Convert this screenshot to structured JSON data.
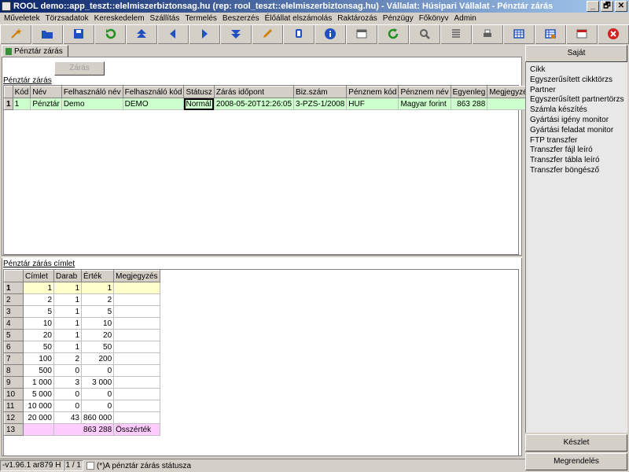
{
  "window": {
    "title": "ROOL demo::app_teszt::elelmiszerbiztonsag.hu (rep: rool_teszt::elelmiszerbiztonsag.hu) - Vállalat: Húsipari Vállalat - Pénztár zárás",
    "controls": [
      "_",
      "🗗",
      "✕"
    ]
  },
  "menu": [
    "Műveletek",
    "Törzsadatok",
    "Kereskedelem",
    "Szállítás",
    "Termelés",
    "Beszerzés",
    "Élőállat elszámolás",
    "Raktározás",
    "Pénzügy",
    "Főkönyv",
    "Admin"
  ],
  "toolbar_icons": [
    {
      "icon": "wand-icon",
      "color": "#d08000"
    },
    {
      "icon": "open-folder-icon",
      "color": "#2050c0"
    },
    {
      "icon": "save-icon",
      "color": "#2050c0"
    },
    {
      "icon": "undo-icon",
      "color": "#209020"
    },
    {
      "icon": "first-record-icon",
      "color": "#2050c0"
    },
    {
      "icon": "previous-record-icon",
      "color": "#2050c0"
    },
    {
      "icon": "next-record-icon",
      "color": "#2050c0"
    },
    {
      "icon": "last-record-icon",
      "color": "#2050c0"
    },
    {
      "icon": "edit-icon",
      "color": "#d08000"
    },
    {
      "icon": "copy-icon",
      "color": "#2050c0"
    },
    {
      "icon": "info-icon",
      "color": "#2050c0"
    },
    {
      "icon": "form-icon",
      "color": "#606060"
    },
    {
      "icon": "refresh-icon",
      "color": "#209020"
    },
    {
      "icon": "search-icon",
      "color": "#606060"
    },
    {
      "icon": "list-icon",
      "color": "#606060"
    },
    {
      "icon": "print-icon",
      "color": "#606060"
    },
    {
      "icon": "table-icon",
      "color": "#2050c0"
    },
    {
      "icon": "table-edit-icon",
      "color": "#2050c0"
    },
    {
      "icon": "window-icon",
      "color": "#c02020"
    },
    {
      "icon": "close-icon",
      "color": "#d02020"
    }
  ],
  "tab": {
    "label": "Pénztár zárás"
  },
  "zaras_button": "Zárás",
  "top_section": {
    "title": "Pénztár zárás",
    "headers": [
      "Kód",
      "Név",
      "Felhasználó név",
      "Felhasználó kód",
      "Státusz",
      "Zárás időpont",
      "Biz.szám",
      "Pénznem kód",
      "Pénznem név",
      "Egyenleg",
      "Megjegyzés"
    ],
    "rows": [
      {
        "rownum": "1",
        "cells": [
          "1",
          "Pénztár",
          "Demo",
          "DEMO",
          "Normál",
          "2008-05-20T12:26:05",
          "3-PZS-1/2008",
          "HUF",
          "Magyar forint",
          "863 288",
          ""
        ]
      }
    ]
  },
  "bottom_section": {
    "title": "Pénztár zárás címlet",
    "headers": [
      "Címlet",
      "Darab",
      "Érték",
      "Megjegyzés"
    ],
    "rows": [
      {
        "rownum": "1",
        "cells": [
          "1",
          "1",
          "1",
          ""
        ]
      },
      {
        "rownum": "2",
        "cells": [
          "2",
          "1",
          "2",
          ""
        ]
      },
      {
        "rownum": "3",
        "cells": [
          "5",
          "1",
          "5",
          ""
        ]
      },
      {
        "rownum": "4",
        "cells": [
          "10",
          "1",
          "10",
          ""
        ]
      },
      {
        "rownum": "5",
        "cells": [
          "20",
          "1",
          "20",
          ""
        ]
      },
      {
        "rownum": "6",
        "cells": [
          "50",
          "1",
          "50",
          ""
        ]
      },
      {
        "rownum": "7",
        "cells": [
          "100",
          "2",
          "200",
          ""
        ]
      },
      {
        "rownum": "8",
        "cells": [
          "500",
          "0",
          "0",
          ""
        ]
      },
      {
        "rownum": "9",
        "cells": [
          "1 000",
          "3",
          "3 000",
          ""
        ]
      },
      {
        "rownum": "10",
        "cells": [
          "5 000",
          "0",
          "0",
          ""
        ]
      },
      {
        "rownum": "11",
        "cells": [
          "10 000",
          "0",
          "0",
          ""
        ]
      },
      {
        "rownum": "12",
        "cells": [
          "20 000",
          "43",
          "860 000",
          ""
        ]
      }
    ],
    "total": {
      "rownum": "13",
      "value": "863 288",
      "label": "Összérték"
    }
  },
  "right_pane": {
    "header": "Saját",
    "items": [
      "Cikk",
      "Egyszerűsített cikktörzs",
      "Partner",
      "Egyszerűsített partnertörzs",
      "Számla készítés",
      "Gyártási igény monitor",
      "Gyártási feladat monitor",
      "FTP transzfer",
      "Transzfer fájl leíró",
      "Transzfer tábla leíró",
      "Transzfer böngésző"
    ],
    "bottom_buttons": [
      "Készlet",
      "Megrendelés"
    ]
  },
  "status_bar": {
    "version": "-v1.96.1 ar879 H",
    "record": "1 / 1",
    "checkbox_label": "(*)A pénztár zárás státusza"
  }
}
